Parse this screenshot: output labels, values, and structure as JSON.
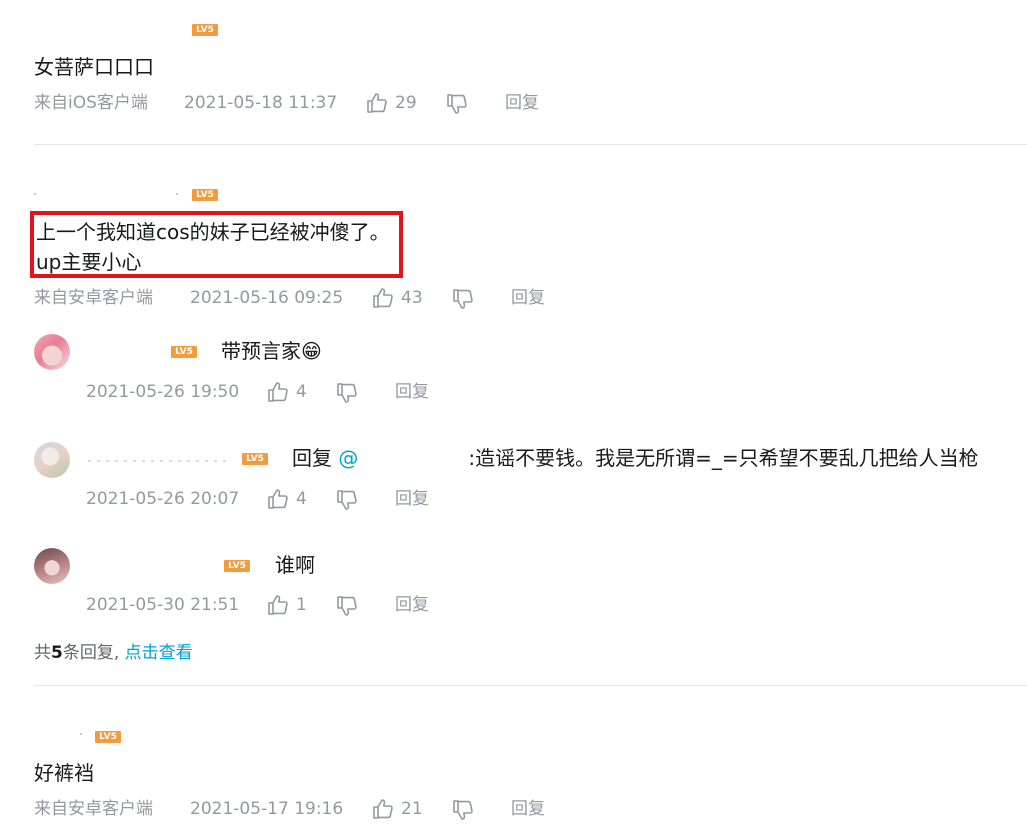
{
  "level_badge": "LV5",
  "colors": {
    "level_badge": "#f39c3d",
    "highlight": "#e0141e",
    "link": "#00a1d6",
    "meta": "#9499a0"
  },
  "comments": [
    {
      "content": "女菩萨口口口",
      "source": "来自iOS客户端",
      "time": "2021-05-18 11:37",
      "likes": "29",
      "reply_label": "回复"
    },
    {
      "content_line1": "上一个我知道cos的妹子已经被冲傻了。",
      "content_line2": "up主要小心",
      "source": "来自安卓客户端",
      "time": "2021-05-16 09:25",
      "likes": "43",
      "reply_label": "回复",
      "sub_replies": [
        {
          "content": "带预言家😁",
          "time": "2021-05-26 19:50",
          "likes": "4",
          "reply_label": "回复"
        },
        {
          "reply_prefix": "回复",
          "mention": "@",
          "content": ":造谣不要钱。我是无所谓=_=只希望不要乱几把给人当枪",
          "time": "2021-05-26 20:07",
          "likes": "4",
          "reply_label": "回复"
        },
        {
          "content": "谁啊",
          "time": "2021-05-30 21:51",
          "likes": "1",
          "reply_label": "回复"
        }
      ],
      "summary_prefix": "共",
      "summary_count": "5",
      "summary_suffix": "条回复,",
      "summary_link": "点击查看"
    },
    {
      "content": "好裤裆",
      "source": "来自安卓客户端",
      "time": "2021-05-17 19:16",
      "likes": "21",
      "reply_label": "回复"
    }
  ]
}
